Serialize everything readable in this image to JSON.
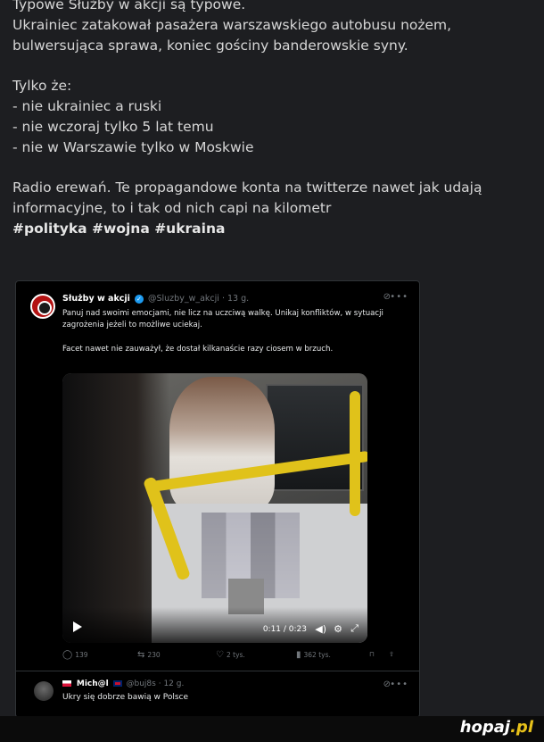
{
  "post": {
    "lines": [
      "Typowe Służby w akcji są typowe.",
      "Ukrainiec zatakował pasażera warszawskiego autobusu nożem,",
      "bulwersująca sprawa, koniec gościny banderowskie syny.",
      "Tylko że:",
      "- nie ukrainiec a ruski",
      "- nie wczoraj tylko 5 lat temu",
      "- nie w Warszawie tylko w Moskwie",
      "Radio erewań. Te propagandowe konta na twitterze nawet jak udają",
      "informacyjne, to i tak od nich capi na kilometr"
    ],
    "hashtags": "#polityka #wojna #ukraina"
  },
  "tweet": {
    "name": "Służby w akcji",
    "handle": "@Sluzby_w_akcji",
    "age": "· 13 g.",
    "grok_icon": "grok-icon",
    "body_1": "Panuj nad swoimi emocjami, nie licz na uczciwą walkę. Unikaj konfliktów, w sytuacji zagrożenia jeżeli to możliwe uciekaj.",
    "body_2": "Facet nawet nie zauważył, że dostał kilkanaście razy ciosem w brzuch.",
    "video": {
      "time": "0:11 / 0:23",
      "progress": 0.48
    },
    "actions": {
      "replies": "139",
      "reposts": "230",
      "likes": "2 tys.",
      "views": "362 tys."
    }
  },
  "reply": {
    "name": "Mich@l",
    "handle": "@buj8s",
    "age": "· 12 g.",
    "text": "Ukry się dobrze bawią w Polsce"
  },
  "watermark": {
    "brand": "hopaj",
    "tld": ".pl"
  }
}
